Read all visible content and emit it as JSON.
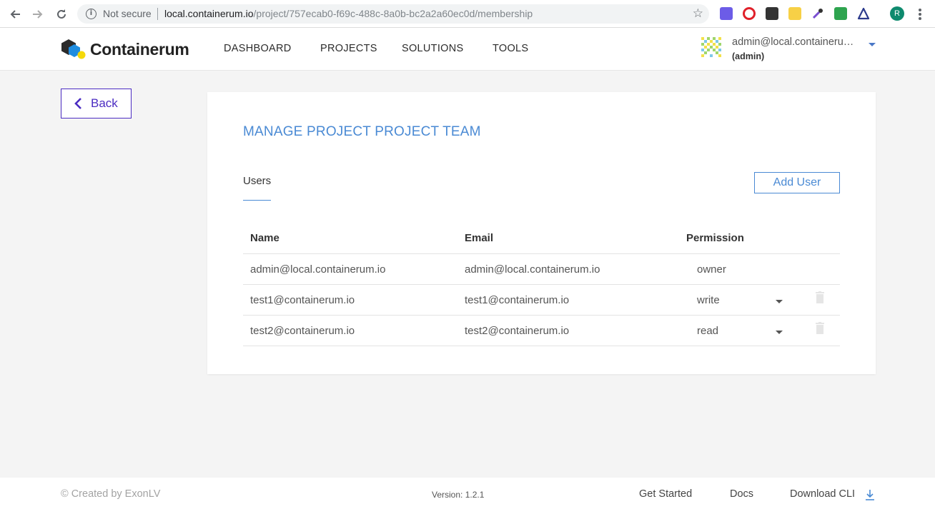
{
  "browser": {
    "secure_label": "Not secure",
    "url_host": "local.containerum.io",
    "url_path": "/project/757ecab0-f69c-488c-8a0b-bc2a2a60ec0d/membership",
    "profile_initial": "R"
  },
  "header": {
    "brand": "Containerum",
    "nav": [
      "DASHBOARD",
      "PROJECTS",
      "SOLUTIONS",
      "TOOLS"
    ],
    "user_email": "admin@local.containerum.io",
    "user_role": "(admin)"
  },
  "back_label": "Back",
  "card": {
    "title": "MANAGE PROJECT PROJECT TEAM",
    "tab": "Users",
    "add_user_label": "Add User",
    "columns": [
      "Name",
      "Email",
      "Permission"
    ],
    "rows": [
      {
        "name": "admin@local.containerum.io",
        "email": "admin@local.containerum.io",
        "permission": "owner"
      },
      {
        "name": "test1@containerum.io",
        "email": "test1@containerum.io",
        "permission": "write"
      },
      {
        "name": "test2@containerum.io",
        "email": "test2@containerum.io",
        "permission": "read"
      }
    ]
  },
  "footer": {
    "copyright": "© Created by ExonLV",
    "version": "Version: 1.2.1",
    "links": [
      "Get Started",
      "Docs",
      "Download CLI"
    ]
  },
  "colors": {
    "accent_blue": "#4a8ad4",
    "back_purple": "#4b2cc2",
    "logo_yellow": "#f5d90a"
  }
}
